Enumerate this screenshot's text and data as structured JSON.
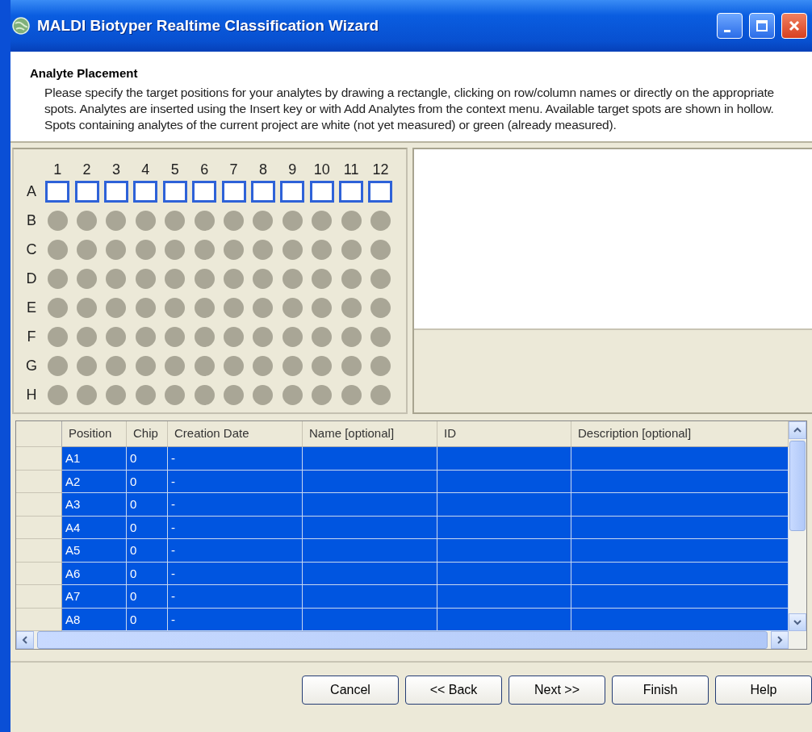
{
  "window": {
    "title": "MALDI Biotyper Realtime Classification Wizard"
  },
  "header": {
    "title": "Analyte Placement",
    "description": "Please specify the target positions for your analytes by drawing a rectangle, clicking on row/column names or directly on the appropriate spots. Analytes are inserted using the Insert key or with Add Analytes from the context menu. Available target spots are shown in hollow. Spots containing analytes of the current project are white (not yet measured) or green (already measured)."
  },
  "plate": {
    "columns": [
      "1",
      "2",
      "3",
      "4",
      "5",
      "6",
      "7",
      "8",
      "9",
      "10",
      "11",
      "12"
    ],
    "rows": [
      {
        "label": "A",
        "kind": "hollow"
      },
      {
        "label": "B",
        "kind": "unavailable"
      },
      {
        "label": "C",
        "kind": "unavailable"
      },
      {
        "label": "D",
        "kind": "unavailable"
      },
      {
        "label": "E",
        "kind": "unavailable"
      },
      {
        "label": "F",
        "kind": "unavailable"
      },
      {
        "label": "G",
        "kind": "unavailable"
      },
      {
        "label": "H",
        "kind": "unavailable"
      }
    ]
  },
  "table": {
    "columns": [
      "Position",
      "Chip",
      "Creation Date",
      "Name [optional]",
      "ID",
      "Description [optional]"
    ],
    "rows": [
      {
        "cells": [
          "A1",
          "0",
          "-"
        ],
        "selected": true
      },
      {
        "cells": [
          "A2",
          "0",
          "-"
        ],
        "selected": true
      },
      {
        "cells": [
          "A3",
          "0",
          "-"
        ],
        "selected": true
      },
      {
        "cells": [
          "A4",
          "0",
          "-"
        ],
        "selected": true
      },
      {
        "cells": [
          "A5",
          "0",
          "-"
        ],
        "selected": true
      },
      {
        "cells": [
          "A6",
          "0",
          "-"
        ],
        "selected": true
      },
      {
        "cells": [
          "A7",
          "0",
          "-"
        ],
        "selected": true
      },
      {
        "cells": [
          "A8",
          "0",
          "-"
        ],
        "selected": true
      }
    ]
  },
  "buttons": [
    "Cancel",
    "<< Back",
    "Next >>",
    "Finish",
    "Help"
  ]
}
